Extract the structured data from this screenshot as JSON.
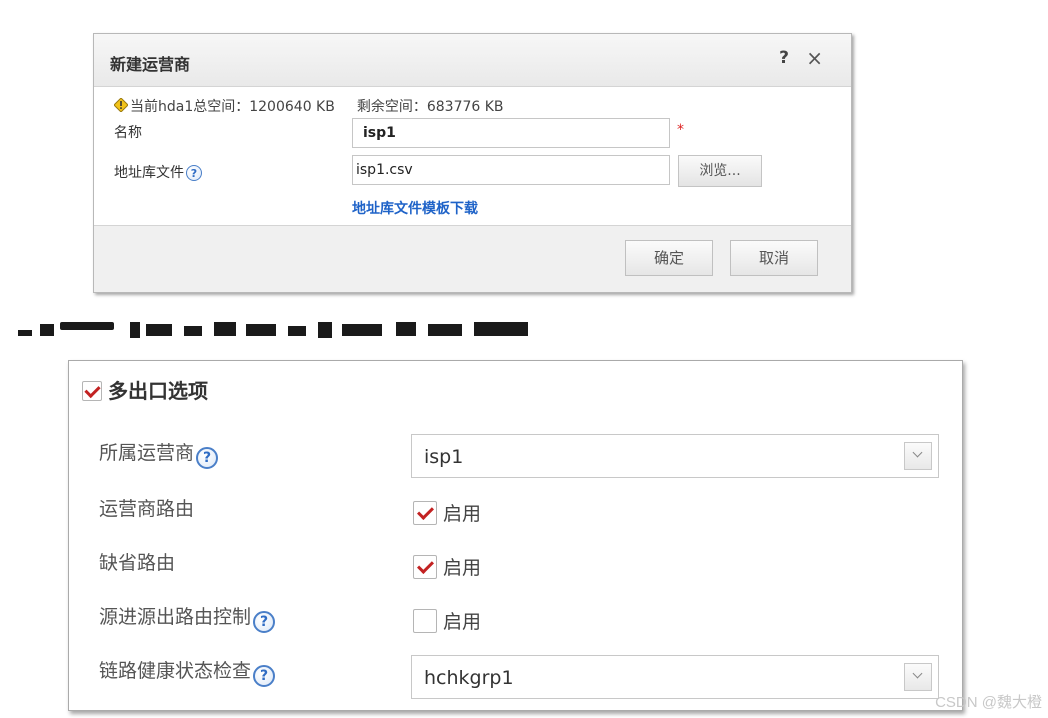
{
  "dialog": {
    "title": "新建运营商",
    "help_label": "?",
    "close_label": "×",
    "space_total": "当前hda1总空间：1200640 KB",
    "space_free": "剩余空间：683776 KB",
    "name_label": "名称",
    "name_value": "isp1",
    "required_mark": "*",
    "file_label": "地址库文件",
    "file_value": "isp1.csv",
    "browse_label": "浏览...",
    "template_link": "地址库文件模板下载",
    "ok_label": "确定",
    "cancel_label": "取消",
    "qmark": "?"
  },
  "panel": {
    "title": "多出口选项",
    "title_checked": true,
    "qmark": "?",
    "rows": [
      {
        "label": "所属运营商",
        "type": "select",
        "value": "isp1"
      },
      {
        "label": "运营商路由",
        "type": "check",
        "checked": true,
        "check_label": "启用"
      },
      {
        "label": "缺省路由",
        "type": "check",
        "checked": true,
        "check_label": "启用"
      },
      {
        "label": "源进源出路由控制",
        "type": "check",
        "checked": false,
        "check_label": "启用"
      },
      {
        "label": "链路健康状态检查",
        "type": "select",
        "value": "hchkgrp1"
      }
    ]
  },
  "watermark": "CSDN @魏大橙",
  "colors": {
    "link": "#1f63c8",
    "check": "#c32222",
    "required": "#dd2222"
  }
}
